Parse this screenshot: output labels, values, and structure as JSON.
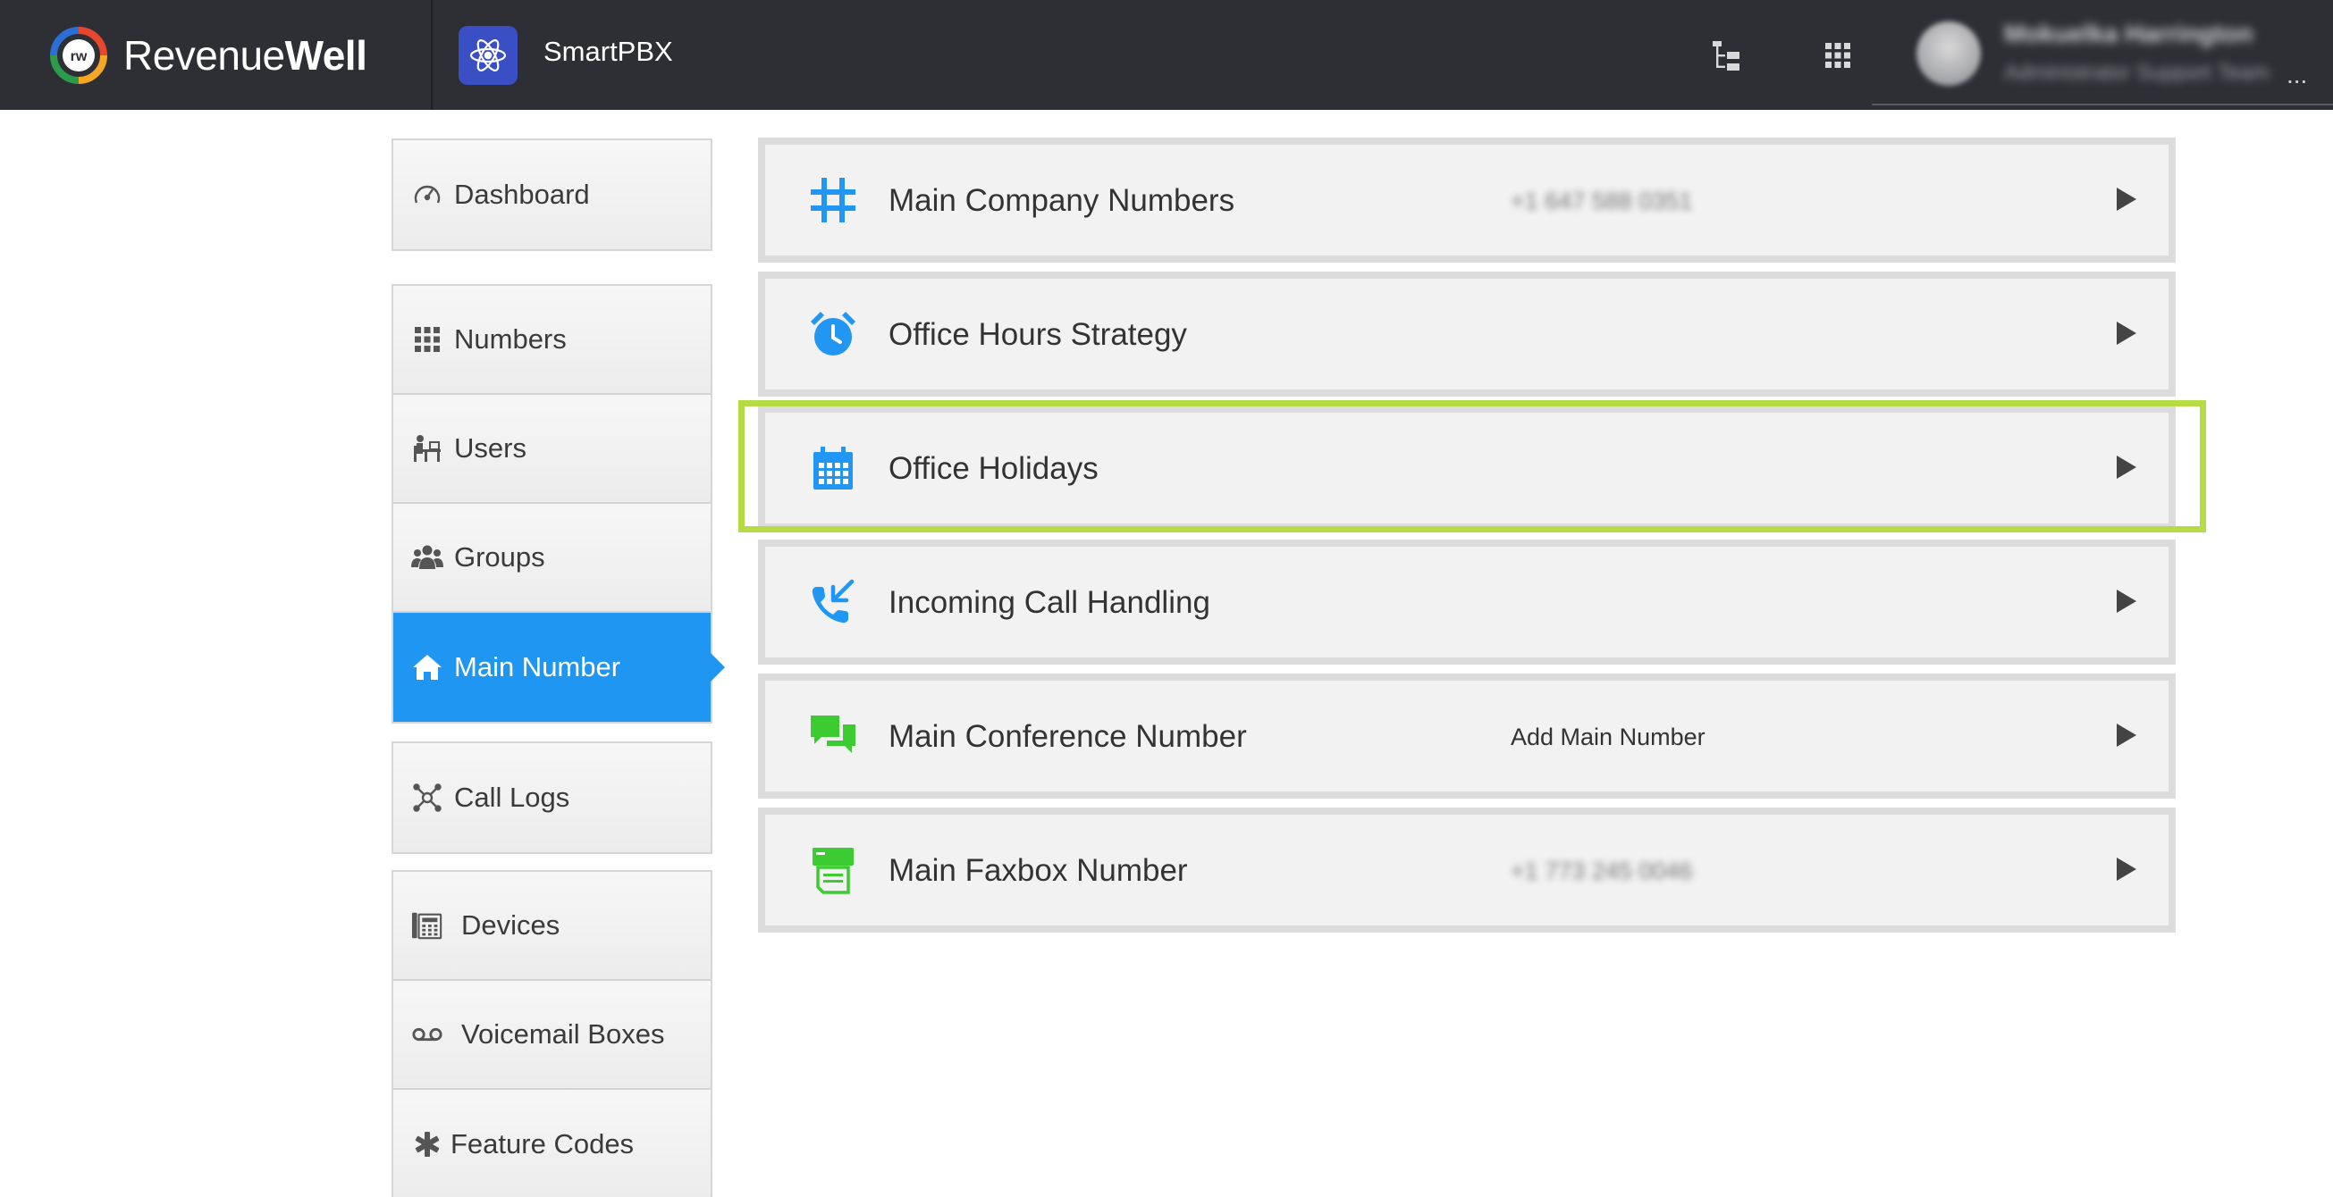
{
  "header": {
    "brand_part1": "Revenue",
    "brand_part2": "Well",
    "app_name": "SmartPBX",
    "user_name": "Mokuelka Harrington",
    "user_role": "Administrator Support Team",
    "more_glyph": "..."
  },
  "sidebar": {
    "groups": [
      {
        "items": [
          {
            "label": "Dashboard",
            "icon": "speedometer-icon"
          }
        ]
      },
      {
        "items": [
          {
            "label": "Numbers",
            "icon": "grid-icon"
          },
          {
            "label": "Users",
            "icon": "user-desk-icon"
          },
          {
            "label": "Groups",
            "icon": "group-icon"
          },
          {
            "label": "Main Number",
            "icon": "home-icon",
            "active": true
          }
        ]
      },
      {
        "items": [
          {
            "label": "Call Logs",
            "icon": "call-logs-icon"
          }
        ]
      },
      {
        "items": [
          {
            "label": "Devices",
            "icon": "devices-icon"
          },
          {
            "label": "Voicemail Boxes",
            "icon": "voicemail-icon"
          },
          {
            "label": "Feature Codes",
            "icon": "asterisk-icon"
          }
        ]
      }
    ]
  },
  "main": {
    "cards": [
      {
        "title": "Main Company Numbers",
        "value": "+1 647 588 0351",
        "value_blurred": true,
        "icon": "hash-icon",
        "icon_color": "#2196f3"
      },
      {
        "title": "Office Hours Strategy",
        "value": "",
        "icon": "alarm-clock-icon",
        "icon_color": "#2196f3"
      },
      {
        "title": "Office Holidays",
        "value": "",
        "icon": "calendar-icon",
        "icon_color": "#2196f3",
        "highlighted": true
      },
      {
        "title": "Incoming Call Handling",
        "value": "",
        "icon": "incoming-call-icon",
        "icon_color": "#2196f3"
      },
      {
        "title": "Main Conference Number",
        "value": "Add Main Number",
        "icon": "chat-icon",
        "icon_color": "#3dcb32"
      },
      {
        "title": "Main Faxbox Number",
        "value": "+1 773 245 0046",
        "value_blurred": true,
        "icon": "fax-icon",
        "icon_color": "#3dcb32"
      }
    ]
  },
  "colors": {
    "topbar": "#2e2f35",
    "active_nav": "#2096f3",
    "highlight": "#b6dc45",
    "blue_icon": "#2196f3",
    "green_icon": "#3dcb32"
  }
}
